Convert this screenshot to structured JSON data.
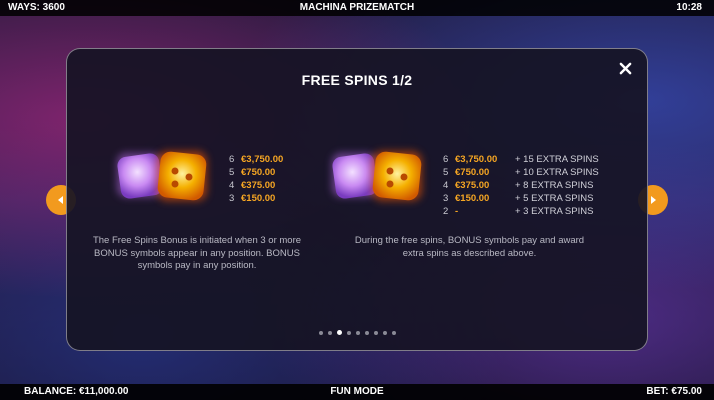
{
  "topbar": {
    "ways": "WAYS: 3600",
    "title": "MACHINA PRIZEMATCH",
    "time": "10:28"
  },
  "panel": {
    "title": "FREE SPINS 1/2",
    "close_icon": "close-icon",
    "left": {
      "rows": [
        {
          "count": "6",
          "value": "€3,750.00"
        },
        {
          "count": "5",
          "value": "€750.00"
        },
        {
          "count": "4",
          "value": "€375.00"
        },
        {
          "count": "3",
          "value": "€150.00"
        }
      ],
      "description": "The Free Spins Bonus is initiated when 3 or more BONUS symbols appear in any position. BONUS symbols pay in any position."
    },
    "right": {
      "rows": [
        {
          "count": "6",
          "value": "€3,750.00",
          "extra": "+ 15 EXTRA SPINS"
        },
        {
          "count": "5",
          "value": "€750.00",
          "extra": "+ 10 EXTRA SPINS"
        },
        {
          "count": "4",
          "value": "€375.00",
          "extra": "+ 8 EXTRA SPINS"
        },
        {
          "count": "3",
          "value": "€150.00",
          "extra": "+ 5 EXTRA SPINS"
        },
        {
          "count": "2",
          "value": "-",
          "extra": "+ 3 EXTRA SPINS"
        }
      ],
      "description": "During the free spins, BONUS symbols pay and award extra spins as described above."
    },
    "pagination": {
      "total": 9,
      "active_index": 2
    }
  },
  "navigation": {
    "prev_icon": "chevron-left-icon",
    "next_icon": "chevron-right-icon"
  },
  "bottombar": {
    "balance": "BALANCE: €11,000.00",
    "mode": "FUN MODE",
    "bet": "BET: €75.00"
  },
  "colors": {
    "accent": "#f29a1e",
    "value": "#f6a623",
    "cube_purple": "#c88cf0",
    "cube_gold": "#f5a100"
  }
}
